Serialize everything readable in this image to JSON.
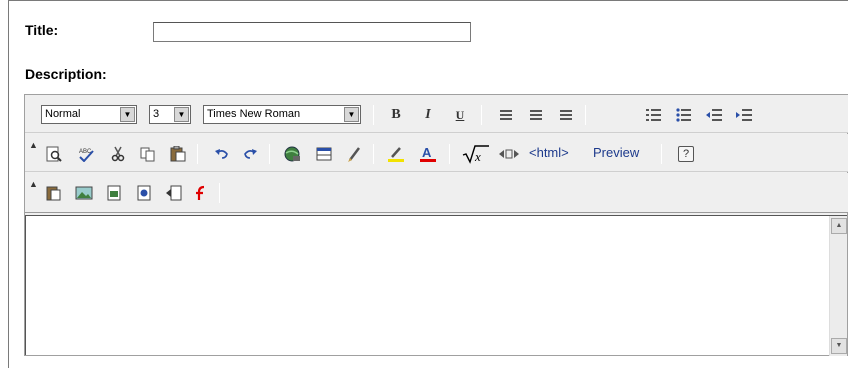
{
  "form": {
    "title_label": "Title:",
    "title_value": "",
    "description_label": "Description:"
  },
  "toolbar1": {
    "format_value": "Normal",
    "size_value": "3",
    "font_value": "Times New Roman",
    "bold": "B",
    "italic": "I",
    "underline": "U"
  },
  "toolbar2": {
    "source_label": "<html>",
    "preview_label": "Preview",
    "help": "?"
  },
  "colors": {
    "toolbar_bg": "#efefef",
    "link_blue": "#1d3a8c",
    "highlight_yellow": "#f2e200",
    "font_color_red": "#e00000"
  },
  "icons": [
    "align-left-icon",
    "align-center-icon",
    "align-right-icon",
    "ordered-list-icon",
    "unordered-list-icon",
    "outdent-icon",
    "indent-icon",
    "find-replace-icon",
    "spellcheck-icon",
    "cut-icon",
    "copy-icon",
    "paste-icon",
    "undo-icon",
    "redo-icon",
    "hyperlink-icon",
    "table-icon",
    "edit-pencil-icon",
    "highlight-icon",
    "font-color-icon",
    "math-formula-icon",
    "code-arrows-icon",
    "insert-document-icon",
    "insert-image-icon",
    "insert-file-icon",
    "insert-media-icon",
    "insert-attachment-icon",
    "flash-icon"
  ]
}
